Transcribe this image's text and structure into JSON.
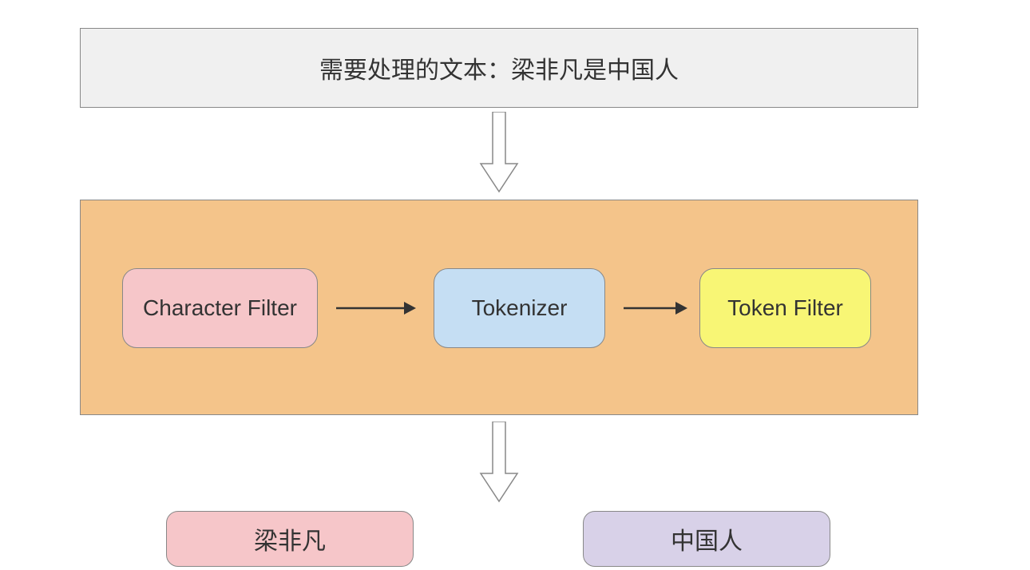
{
  "input": {
    "label": "需要处理的文本：梁非凡是中国人"
  },
  "pipeline": {
    "stages": [
      {
        "label": "Character Filter"
      },
      {
        "label": "Tokenizer"
      },
      {
        "label": "Token Filter"
      }
    ]
  },
  "outputs": [
    {
      "label": "梁非凡"
    },
    {
      "label": "中国人"
    }
  ]
}
